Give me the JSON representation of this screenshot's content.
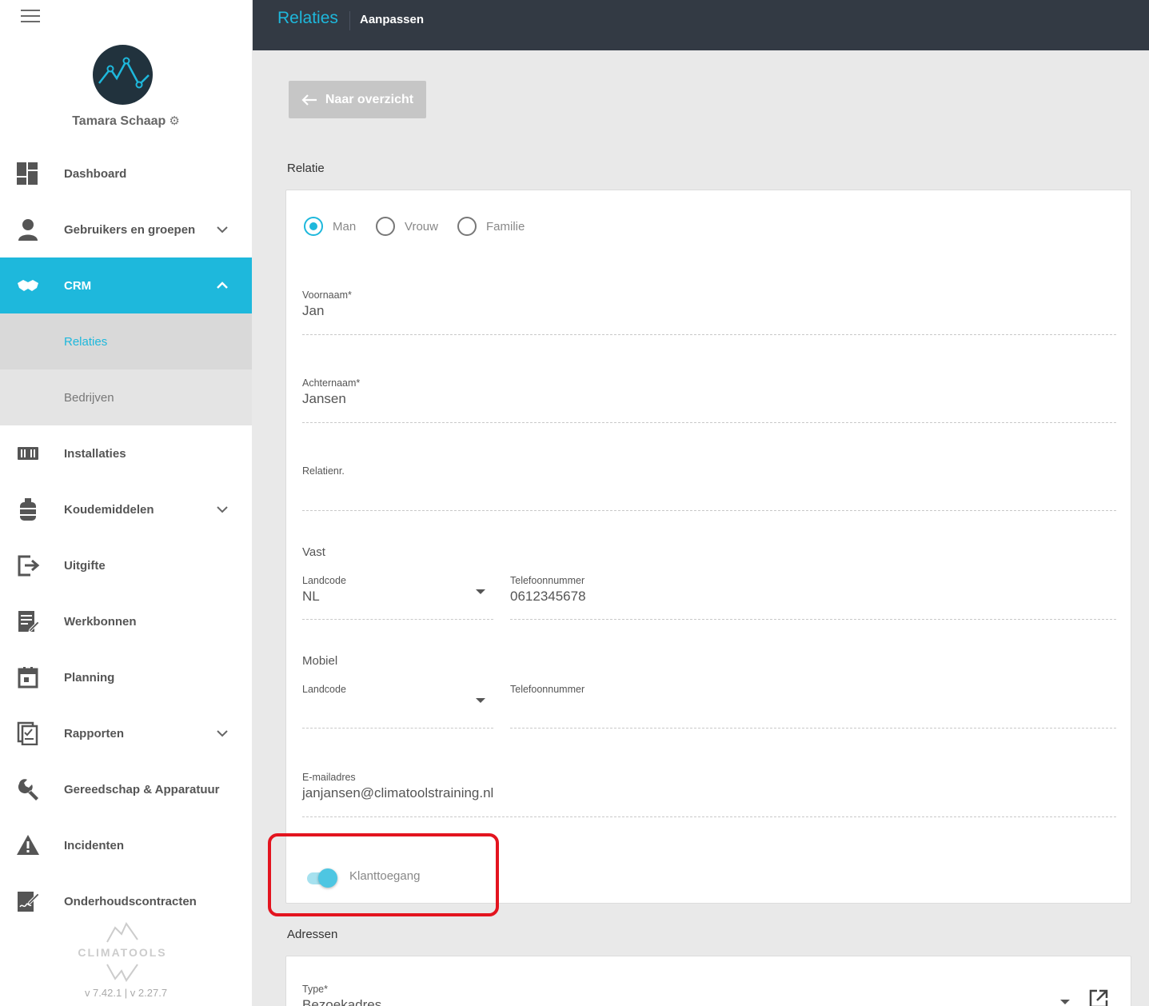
{
  "sidebar": {
    "user_name": "Tamara Schaap",
    "menu_icon": "hamburger-icon",
    "items": [
      {
        "label": "Dashboard",
        "icon": "dashboard-icon"
      },
      {
        "label": "Gebruikers en groepen",
        "icon": "user-icon"
      },
      {
        "label": "CRM",
        "icon": "handshake-icon"
      },
      {
        "label": "Relaties"
      },
      {
        "label": "Bedrijven"
      },
      {
        "label": "Installaties",
        "icon": "installation-icon"
      },
      {
        "label": "Koudemiddelen",
        "icon": "gas-cylinder-icon"
      },
      {
        "label": "Uitgifte",
        "icon": "exit-icon"
      },
      {
        "label": "Werkbonnen",
        "icon": "document-edit-icon"
      },
      {
        "label": "Planning",
        "icon": "calendar-icon"
      },
      {
        "label": "Rapporten",
        "icon": "report-icon"
      },
      {
        "label": "Gereedschap & Apparatuur",
        "icon": "wrench-icon"
      },
      {
        "label": "Incidenten",
        "icon": "warning-icon"
      },
      {
        "label": "Onderhoudscontracten",
        "icon": "contract-icon"
      }
    ],
    "brand": "CLIMATOOLS",
    "version": "v 7.42.1  | v 2.27.7"
  },
  "topbar": {
    "title": "Relaties",
    "subtitle": "Aanpassen"
  },
  "main": {
    "back_label": "Naar overzicht",
    "section_relatie": "Relatie",
    "gender": {
      "options": [
        "Man",
        "Vrouw",
        "Familie"
      ],
      "selected": "Man"
    },
    "voornaam": {
      "label": "Voornaam*",
      "value": "Jan"
    },
    "achternaam": {
      "label": "Achternaam*",
      "value": "Jansen"
    },
    "relatienr": {
      "label": "Relatienr.",
      "value": ""
    },
    "vast": {
      "title": "Vast",
      "landcode_label": "Landcode",
      "landcode_value": "NL",
      "telefoon_label": "Telefoonnummer",
      "telefoon_value": "0612345678"
    },
    "mobiel": {
      "title": "Mobiel",
      "landcode_label": "Landcode",
      "landcode_value": "",
      "telefoon_label": "Telefoonnummer",
      "telefoon_value": ""
    },
    "email": {
      "label": "E-mailadres",
      "value": "janjansen@climatoolstraining.nl"
    },
    "klanttoegang": {
      "label": "Klanttoegang",
      "enabled": true
    },
    "section_adressen": "Adressen",
    "address_type": {
      "label": "Type*",
      "value": "Bezoekadres"
    }
  },
  "colors": {
    "accent": "#1eb8dc",
    "topbar": "#333a44",
    "highlight": "#e3141f"
  }
}
